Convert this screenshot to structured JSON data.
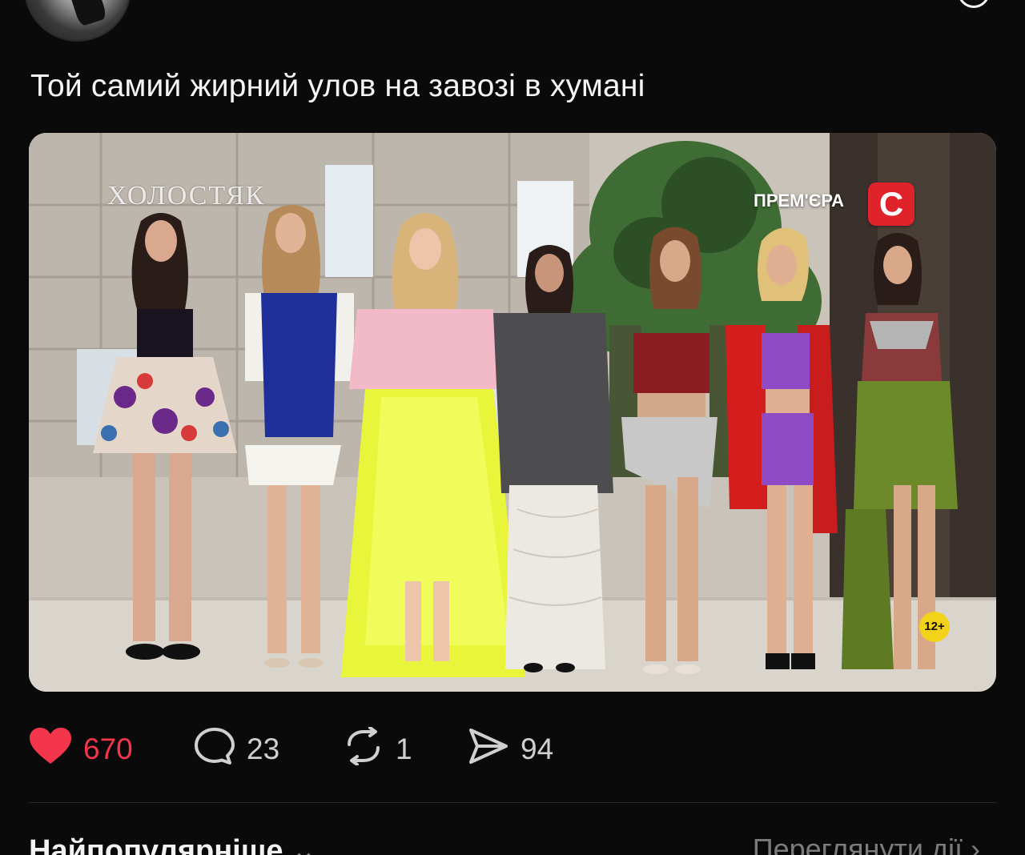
{
  "post": {
    "username": "",
    "time": "",
    "text": "Той самий жирний улов на завозі в хумані"
  },
  "image": {
    "logo_text": "ХОЛОСТЯК",
    "premiere_text": "ПРЕМ'ЄРА",
    "channel_letter": "C",
    "age_rating": "12+",
    "colors": {
      "channel_red": "#e0232a",
      "badge_yellow": "#f3d21a"
    }
  },
  "actions": {
    "likes": "670",
    "comments": "23",
    "reposts": "1",
    "shares": "94",
    "like_color": "#f4364c"
  },
  "footer": {
    "section_title": "Найпопулярніше",
    "view_activity": "Переглянути дії"
  }
}
